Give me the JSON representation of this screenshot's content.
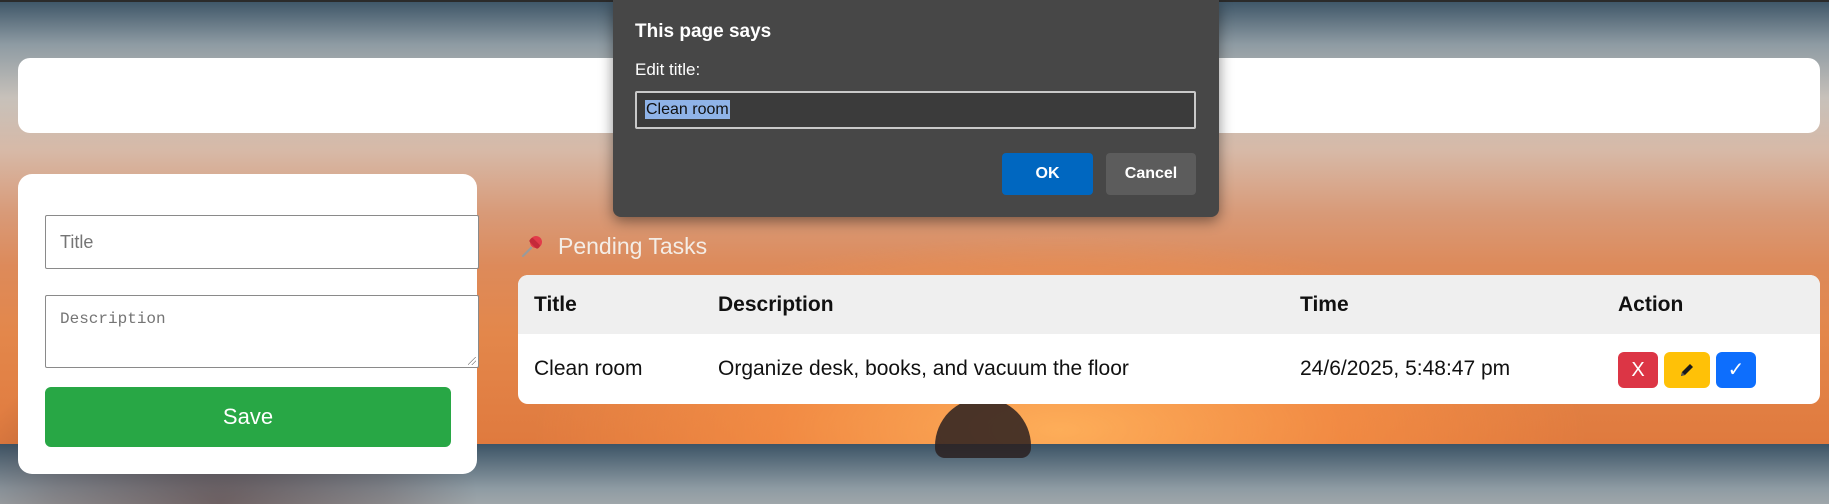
{
  "form": {
    "title_placeholder": "Title",
    "description_placeholder": "Description",
    "save_label": "Save"
  },
  "pending": {
    "heading": "Pending Tasks",
    "icon": "pushpin-icon",
    "columns": [
      "Title",
      "Description",
      "Time",
      "Action"
    ],
    "rows": [
      {
        "title": "Clean room",
        "description": "Organize desk, books, and vacuum the floor",
        "time": "24/6/2025, 5:48:47 pm",
        "actions": {
          "delete": "X",
          "edit": "pencil-icon",
          "complete": "✓"
        }
      }
    ]
  },
  "dialog": {
    "heading": "This page says",
    "message": "Edit title:",
    "input_value": "Clean room",
    "ok_label": "OK",
    "cancel_label": "Cancel"
  },
  "colors": {
    "save": "#28a745",
    "delete": "#dc3545",
    "edit": "#ffc107",
    "complete": "#0d6efd",
    "dialog_bg": "#474747",
    "dialog_ok": "#0067c0"
  }
}
